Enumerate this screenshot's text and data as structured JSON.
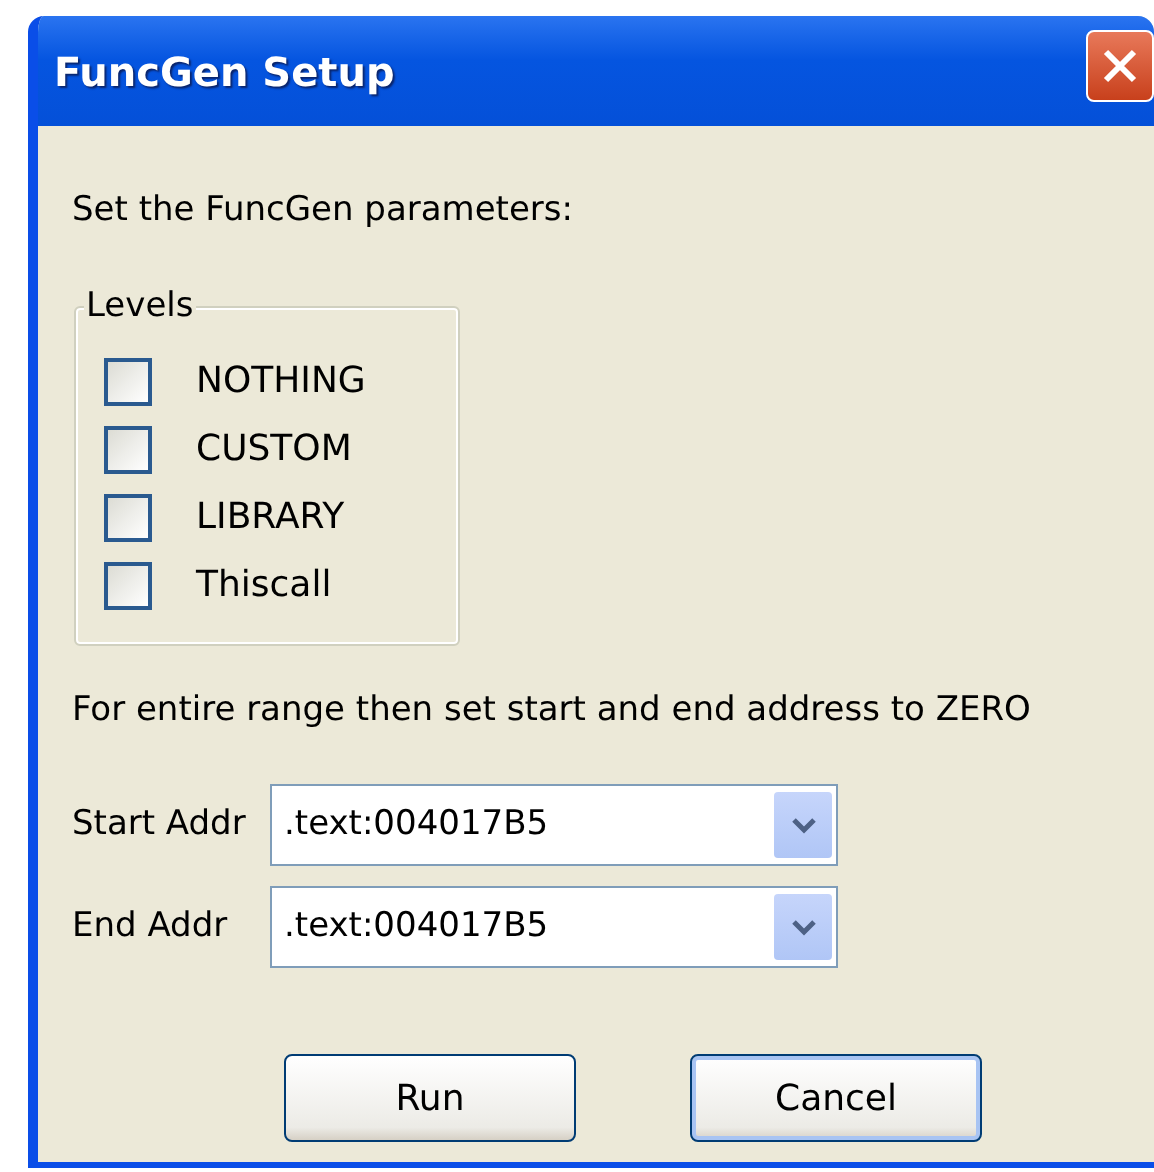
{
  "window": {
    "title": "FuncGen Setup"
  },
  "instruction": "Set the FuncGen parameters:",
  "levels": {
    "title": "Levels",
    "options": [
      {
        "label": "NOTHING",
        "checked": false
      },
      {
        "label": "CUSTOM",
        "checked": false
      },
      {
        "label": "LIBRARY",
        "checked": false
      },
      {
        "label": "Thiscall",
        "checked": false
      }
    ]
  },
  "range_note": "For entire range then set start and end address to ZERO",
  "fields": [
    {
      "label": "Start Addr",
      "value": ".text:004017B5"
    },
    {
      "label": "End Addr",
      "value": ".text:004017B5"
    }
  ],
  "buttons": [
    {
      "label": "Run",
      "default": false
    },
    {
      "label": "Cancel",
      "default": true
    }
  ]
}
